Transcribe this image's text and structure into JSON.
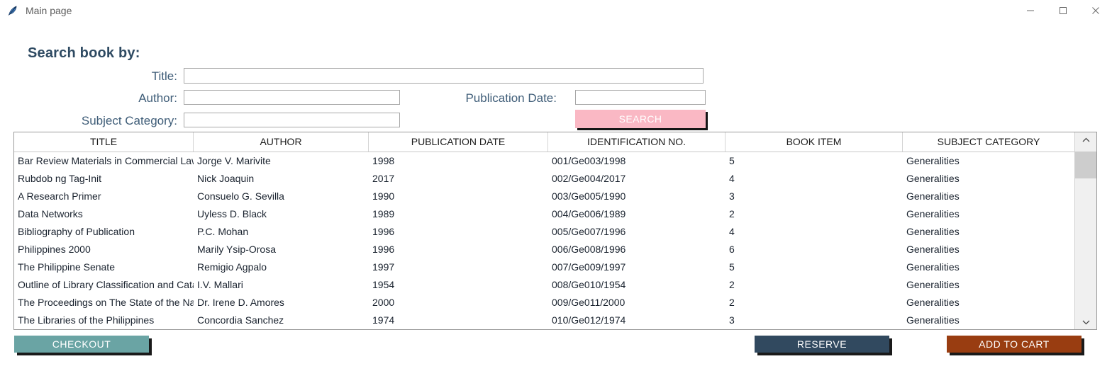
{
  "window": {
    "title": "Main page",
    "app_icon": "feather-icon",
    "controls": {
      "minimize": "minimize-icon",
      "maximize": "maximize-icon",
      "close": "close-icon"
    }
  },
  "search_form": {
    "heading": "Search book by:",
    "fields": {
      "title": {
        "label": "Title:",
        "value": "",
        "placeholder": ""
      },
      "author": {
        "label": "Author:",
        "value": "",
        "placeholder": ""
      },
      "pubdate": {
        "label": "Publication Date:",
        "value": "",
        "placeholder": ""
      },
      "subject": {
        "label": "Subject Category:",
        "value": "",
        "placeholder": ""
      }
    },
    "search_button": {
      "label": "SEARCH",
      "color": "#fab8c4"
    }
  },
  "table": {
    "columns": [
      "TITLE",
      "AUTHOR",
      "PUBLICATION DATE",
      "IDENTIFICATION NO.",
      "BOOK ITEM",
      "SUBJECT CATEGORY"
    ],
    "rows": [
      {
        "title": "Bar Review Materials in Commercial Law",
        "author": "Jorge V. Marivite",
        "pubdate": "1998",
        "idno": "001/Ge003/1998",
        "book_item": "5",
        "subject": "Generalities"
      },
      {
        "title": "Rubdob ng Tag-Init",
        "author": "Nick Joaquin",
        "pubdate": "2017",
        "idno": "002/Ge004/2017",
        "book_item": "4",
        "subject": "Generalities"
      },
      {
        "title": "A Research Primer",
        "author": "Consuelo G. Sevilla",
        "pubdate": "1990",
        "idno": "003/Ge005/1990",
        "book_item": "3",
        "subject": "Generalities"
      },
      {
        "title": "Data Networks",
        "author": "Uyless D. Black",
        "pubdate": "1989",
        "idno": "004/Ge006/1989",
        "book_item": "2",
        "subject": "Generalities"
      },
      {
        "title": "Bibliography of Publication",
        "author": "P.C. Mohan",
        "pubdate": "1996",
        "idno": "005/Ge007/1996",
        "book_item": "4",
        "subject": "Generalities"
      },
      {
        "title": "Philippines 2000",
        "author": "Marily Ysip-Orosa",
        "pubdate": "1996",
        "idno": "006/Ge008/1996",
        "book_item": "6",
        "subject": "Generalities"
      },
      {
        "title": "The Philippine Senate",
        "author": "Remigio Agpalo",
        "pubdate": "1997",
        "idno": "007/Ge009/1997",
        "book_item": "5",
        "subject": "Generalities"
      },
      {
        "title": "Outline of Library Classification and Cataloguing",
        "author": "I.V. Mallari",
        "pubdate": "1954",
        "idno": "008/Ge010/1954",
        "book_item": "2",
        "subject": "Generalities"
      },
      {
        "title": "The Proceedings on The State of the Nation",
        "author": "Dr. Irene D. Amores",
        "pubdate": "2000",
        "idno": "009/Ge011/2000",
        "book_item": "2",
        "subject": "Generalities"
      },
      {
        "title": "The Libraries of the Philippines",
        "author": "Concordia Sanchez",
        "pubdate": "1974",
        "idno": "010/Ge012/1974",
        "book_item": "3",
        "subject": "Generalities"
      }
    ],
    "scrollbar": {
      "up_arrow": "chevron-up-icon",
      "down_arrow": "chevron-down-icon"
    }
  },
  "actions": {
    "checkout": {
      "label": "CHECKOUT",
      "color": "#6aa4a4"
    },
    "reserve": {
      "label": "RESERVE",
      "color": "#31495f"
    },
    "add_to_cart": {
      "label": "ADD TO CART",
      "color": "#993d11"
    }
  }
}
